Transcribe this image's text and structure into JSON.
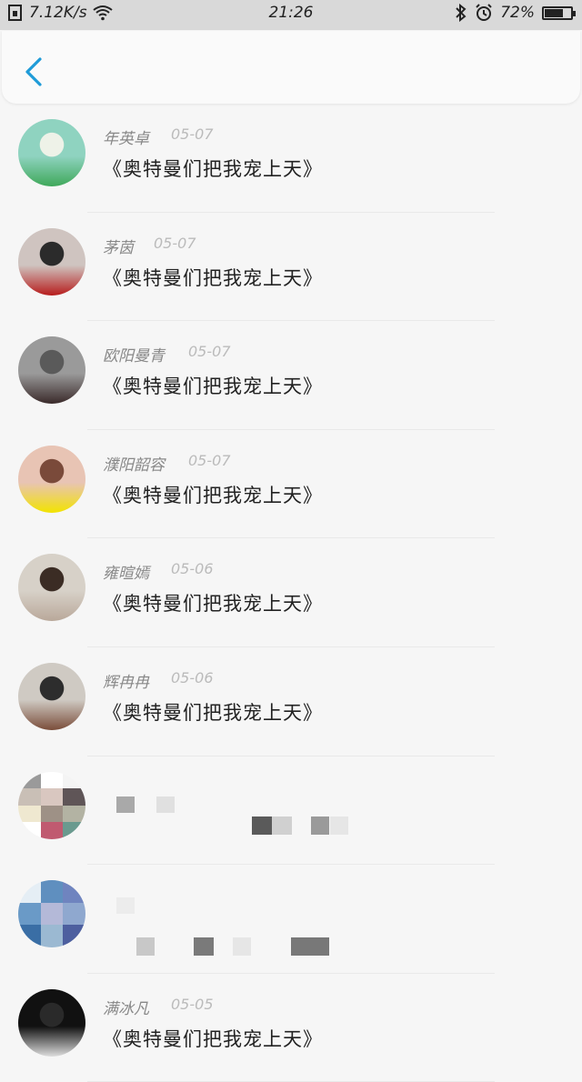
{
  "status_bar": {
    "net_speed": "7.12K/s",
    "time": "21:26",
    "battery": "72%",
    "battery_level": 0.72,
    "icons": [
      "sim-icon",
      "wifi-icon",
      "bluetooth-icon",
      "alarm-icon",
      "battery-icon"
    ]
  },
  "header": {
    "back_icon": "chevron-left-icon"
  },
  "messages": [
    {
      "name": "年英卓",
      "date": "05-07",
      "text": "《奥特曼们把我宠上天》",
      "avatar_colors": [
        "#8fd3c0",
        "#eef2e8",
        "#3fa85a"
      ]
    },
    {
      "name": "茅茵",
      "date": "05-07",
      "text": "《奥特曼们把我宠上天》",
      "avatar_colors": [
        "#cfc4c0",
        "#2b2b2b",
        "#b71c1c"
      ]
    },
    {
      "name": "欧阳曼青",
      "date": "05-07",
      "text": "《奥特曼们把我宠上天》",
      "avatar_colors": [
        "#9a9a9a",
        "#5a5a5a",
        "#3a2a2a"
      ]
    },
    {
      "name": "濮阳韶容",
      "date": "05-07",
      "text": "《奥特曼们把我宠上天》",
      "avatar_colors": [
        "#e8c4b4",
        "#7a4a3a",
        "#f2e300"
      ]
    },
    {
      "name": "雍暄嫣",
      "date": "05-06",
      "text": "《奥特曼们把我宠上天》",
      "avatar_colors": [
        "#d7d1c8",
        "#3b2c24",
        "#b9a89a"
      ]
    },
    {
      "name": "辉冉冉",
      "date": "05-06",
      "text": "《奥特曼们把我宠上天》",
      "avatar_colors": [
        "#cfcac3",
        "#2d2d2d",
        "#7a4d3a"
      ]
    },
    {
      "name": "",
      "date": "",
      "text": "",
      "pixelated": true
    },
    {
      "name": "",
      "date": "",
      "text": "",
      "pixelated": true
    },
    {
      "name": "满冰凡",
      "date": "05-05",
      "text": "《奥特曼们把我宠上天》",
      "avatar_colors": [
        "#111111",
        "#2a2a2a",
        "#dddddd"
      ]
    }
  ]
}
